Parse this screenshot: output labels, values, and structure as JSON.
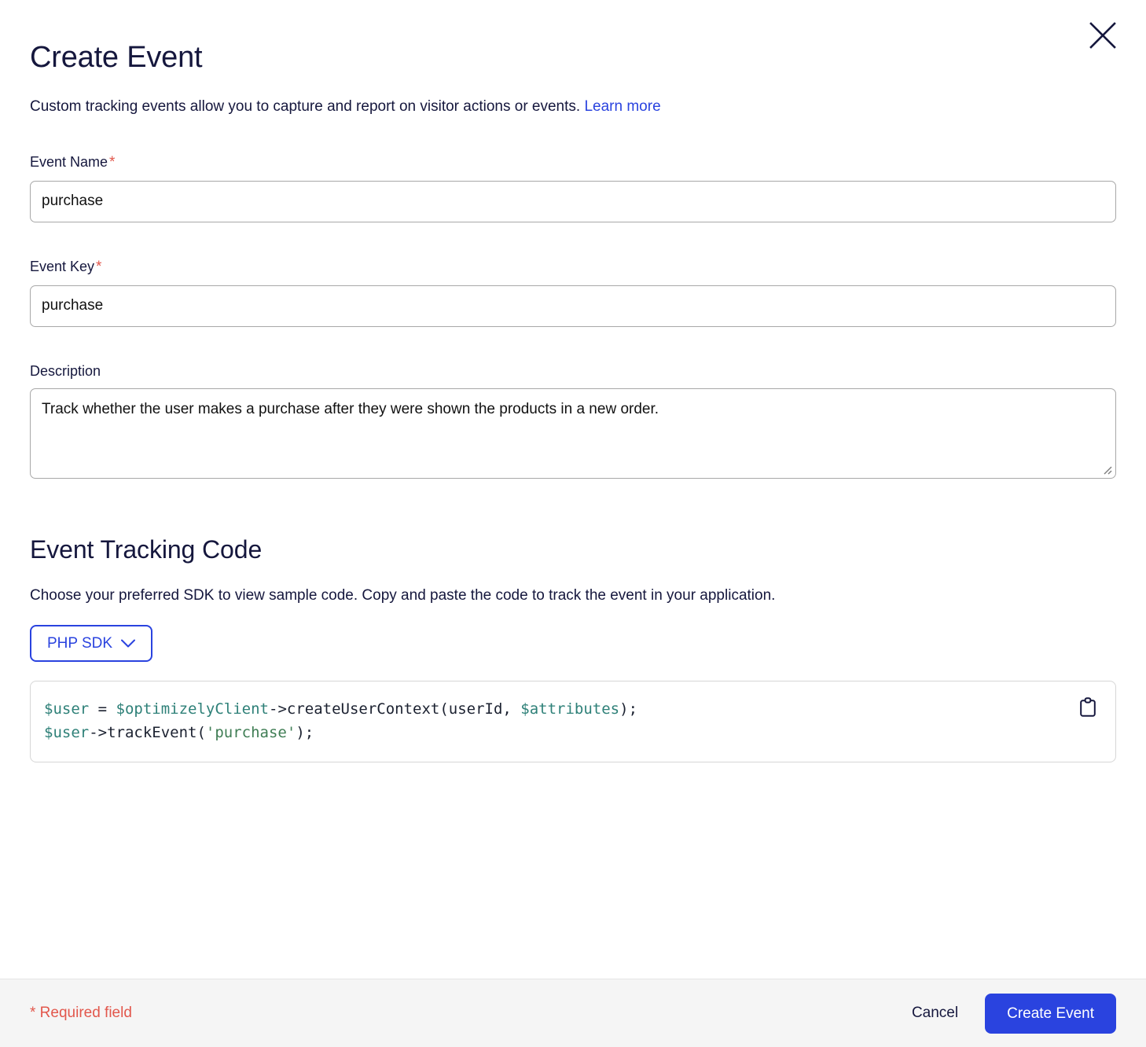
{
  "modal": {
    "title": "Create Event",
    "subtitle": "Custom tracking events allow you to capture and report on visitor actions or events.",
    "learn_more_label": "Learn more",
    "close_icon": "close-icon"
  },
  "form": {
    "event_name": {
      "label": "Event Name",
      "required_marker": "*",
      "value": "purchase",
      "placeholder": ""
    },
    "event_key": {
      "label": "Event Key",
      "required_marker": "*",
      "value": "purchase",
      "placeholder": ""
    },
    "description": {
      "label": "Description",
      "value": "Track whether the user makes a purchase after they were shown the products in a new order.",
      "placeholder": ""
    }
  },
  "tracking_code": {
    "heading": "Event Tracking Code",
    "description": "Choose your preferred SDK to view sample code. Copy and paste the code to track the event in your application.",
    "sdk_selector": {
      "selected": "PHP SDK",
      "chevron_icon": "chevron-down-icon"
    },
    "copy_icon": "clipboard-copy-icon",
    "lines": [
      [
        {
          "t": "$user ",
          "c": "var"
        },
        {
          "t": "= ",
          "c": "plain"
        },
        {
          "t": "$optimizelyClient",
          "c": "var"
        },
        {
          "t": "->createUserContext(userId, ",
          "c": "plain"
        },
        {
          "t": "$attributes",
          "c": "var"
        },
        {
          "t": ");",
          "c": "plain"
        }
      ],
      [
        {
          "t": "$user",
          "c": "var"
        },
        {
          "t": "->trackEvent(",
          "c": "plain"
        },
        {
          "t": "'purchase'",
          "c": "str"
        },
        {
          "t": ");",
          "c": "plain"
        }
      ]
    ]
  },
  "footer": {
    "required_note": "* Required field",
    "cancel_label": "Cancel",
    "submit_label": "Create Event"
  },
  "colors": {
    "accent_blue": "#2a43df",
    "required_red": "#e2574c",
    "text_navy": "#15173d",
    "code_var_teal": "#2e8078",
    "code_string_green": "#3f7d54",
    "footer_bg": "#f5f5f5"
  }
}
